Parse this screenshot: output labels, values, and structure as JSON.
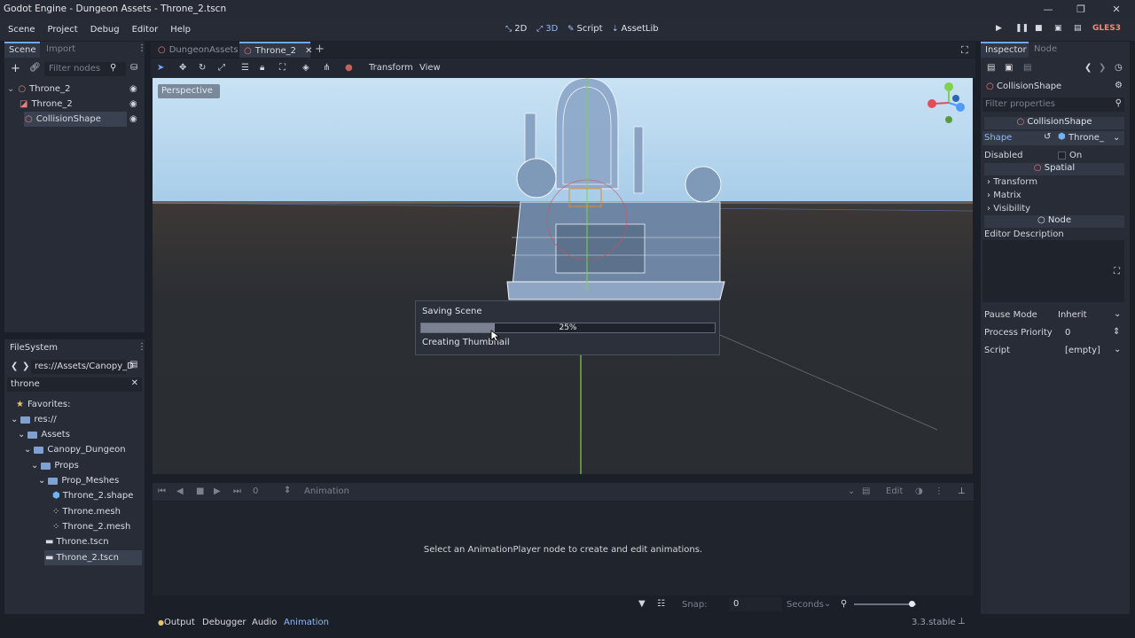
{
  "window": {
    "title": "Godot Engine - Dungeon Assets - Throne_2.tscn",
    "minimize": "—",
    "maximize": "❐",
    "close": "✕"
  },
  "menu": [
    "Scene",
    "Project",
    "Debug",
    "Editor",
    "Help"
  ],
  "modes": {
    "m2d": "2D",
    "m3d": "3D",
    "script": "Script",
    "assetlib": "AssetLib"
  },
  "renderer": "GLES3",
  "scene_dock": {
    "tabs": {
      "scene": "Scene",
      "import": "Import"
    },
    "filter_placeholder": "Filter nodes",
    "nodes": [
      {
        "label": "Throne_2"
      },
      {
        "label": "Throne_2"
      },
      {
        "label": "CollisionShape"
      }
    ]
  },
  "editor_tabs": {
    "tab1": "DungeonAssets",
    "tab2": "Throne_2"
  },
  "viewport_toolbar": {
    "transform": "Transform",
    "view": "View"
  },
  "viewport": {
    "perspective": "Perspective"
  },
  "progress": {
    "title": "Saving Scene",
    "percent_text": "25%",
    "percent": 0.25,
    "step": "Creating Thumbnail"
  },
  "filesystem": {
    "title": "FileSystem",
    "path": "res://Assets/Canopy_D",
    "search": "throne",
    "items": [
      {
        "label": "Favorites:"
      },
      {
        "label": "res://"
      },
      {
        "label": "Assets"
      },
      {
        "label": "Canopy_Dungeon"
      },
      {
        "label": "Props"
      },
      {
        "label": "Prop_Meshes"
      },
      {
        "label": "Throne_2.shape"
      },
      {
        "label": "Throne.mesh"
      },
      {
        "label": "Throne_2.mesh"
      },
      {
        "label": "Throne.tscn"
      },
      {
        "label": "Throne_2.tscn"
      }
    ]
  },
  "animation": {
    "frame": "0",
    "title": "Animation",
    "edit": "Edit",
    "message": "Select an AnimationPlayer node to create and edit animations.",
    "snap_label": "Snap:",
    "snap_value": "0",
    "unit": "Seconds"
  },
  "bottom_tabs": {
    "output": "Output",
    "debugger": "Debugger",
    "audio": "Audio",
    "animation": "Animation"
  },
  "version": "3.3.stable",
  "inspector": {
    "tabs": {
      "inspector": "Inspector",
      "node": "Node"
    },
    "object": "CollisionShape",
    "filter_placeholder": "Filter properties",
    "section_collision": "CollisionShape",
    "shape_label": "Shape",
    "shape_value": "Throne_",
    "disabled_label": "Disabled",
    "disabled_value": "On",
    "section_spatial": "Spatial",
    "transform": "Transform",
    "matrix": "Matrix",
    "visibility": "Visibility",
    "section_node": "Node",
    "editor_desc": "Editor Description",
    "pause_label": "Pause Mode",
    "pause_value": "Inherit",
    "priority_label": "Process Priority",
    "priority_value": "0",
    "script_label": "Script",
    "script_value": "[empty]"
  },
  "colors": {
    "accent": "#6fa8ff",
    "bg": "#1b1f28",
    "panel": "#272c36",
    "sky": "#a8cde9"
  }
}
